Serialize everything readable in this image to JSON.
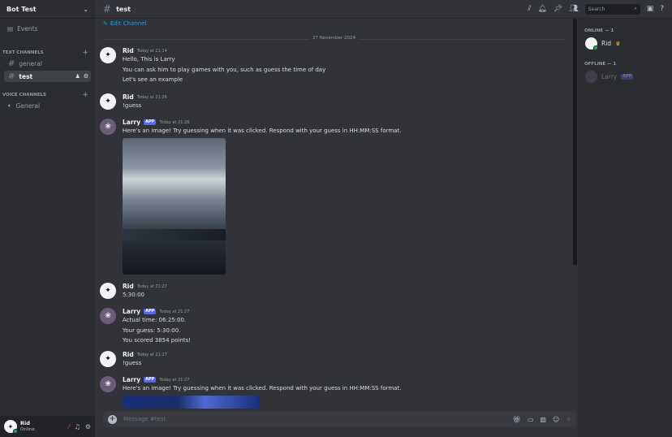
{
  "server": {
    "name": "Bot Test"
  },
  "sidebar": {
    "events_label": "Events",
    "text_category": "TEXT CHANNELS",
    "voice_category": "VOICE CHANNELS",
    "text_channels": [
      {
        "name": "general",
        "active": false
      },
      {
        "name": "test",
        "active": true
      }
    ],
    "voice_channels": [
      {
        "name": "General"
      }
    ]
  },
  "user": {
    "name": "Rid",
    "status": "Online"
  },
  "topbar": {
    "channel": "test",
    "search_placeholder": "Search"
  },
  "chat": {
    "edit_channel": "Edit Channel",
    "date_divider": "27 November 2024",
    "messages": [
      {
        "author": "Rid",
        "time": "Today at 21:14",
        "lines": [
          "Hello, This is Larry",
          "You can ask him to play games with you, such as guess the time of day",
          "Let's see an example"
        ]
      },
      {
        "author": "Rid",
        "time": "Today at 21:26",
        "lines": [
          "!guess"
        ]
      },
      {
        "author": "Larry",
        "tag": "APP",
        "time": "Today at 21:26",
        "lines": [
          "Here's an image! Try guessing when it was clicked. Respond with your guess in HH:MM:SS format."
        ]
      },
      {
        "author": "Rid",
        "time": "Today at 21:27",
        "lines": [
          "5:30:00"
        ]
      },
      {
        "author": "Larry",
        "tag": "APP",
        "time": "Today at 21:27",
        "lines": [
          "Actual time: 06:25:00.",
          "Your guess: 5:30:00.",
          "You scored 3854 points!"
        ]
      },
      {
        "author": "Rid",
        "time": "Today at 21:27",
        "lines": [
          "!guess"
        ]
      },
      {
        "author": "Larry",
        "tag": "APP",
        "time": "Today at 21:27",
        "lines": [
          "Here's an image! Try guessing when it was clicked. Respond with your guess in HH:MM:SS format."
        ]
      }
    ]
  },
  "composer": {
    "placeholder": "Message #test"
  },
  "members": {
    "online_label": "ONLINE — 1",
    "offline_label": "OFFLINE — 1",
    "online": [
      {
        "name": "Rid"
      }
    ],
    "offline": [
      {
        "name": "Larry",
        "tag": "APP"
      }
    ]
  }
}
